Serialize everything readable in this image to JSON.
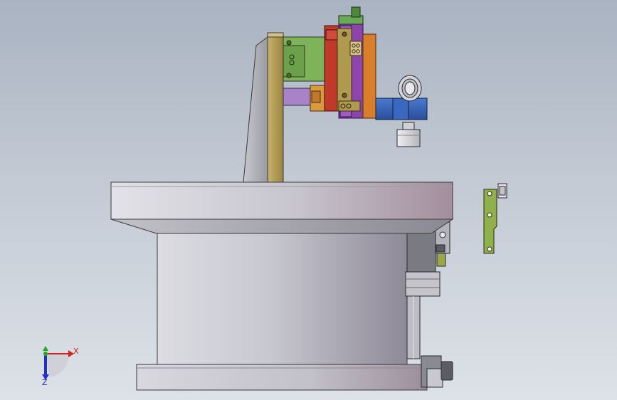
{
  "view": {
    "background_top": "#a9b3c1",
    "background_bottom": "#dde2e8"
  },
  "triad": {
    "x_label": "X",
    "z_label": "Z",
    "x_color": "#d42020",
    "y_color": "#18b018",
    "z_color": "#2030c8"
  },
  "colors": {
    "steel_light": "#e6e6ea",
    "steel_mid": "#b8b8c0",
    "steel_dark": "#8c8c96",
    "bracket_olive": "#b09a50",
    "plate_green": "#7fb35a",
    "block_red": "#c0392b",
    "slide_purple": "#8e44ad",
    "arm_lavender": "#a883c8",
    "cylinder_blue": "#2e5fb8",
    "block_orange": "#d97f2a",
    "small_plate_green": "#8fb04a"
  }
}
